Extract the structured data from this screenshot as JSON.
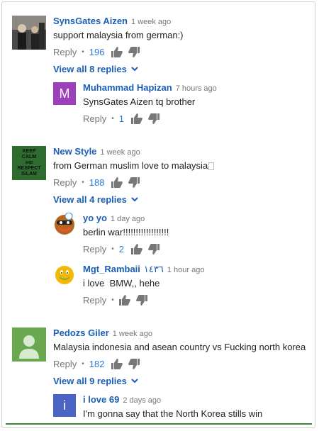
{
  "comments": [
    {
      "author": "SynsGates Aizen",
      "time": "1 week ago",
      "text": "support malaysia from german:)",
      "reply_label": "Reply",
      "likes": "196",
      "view_replies": "View all 8 replies",
      "avatar": "photo-avatar"
    },
    {
      "author": "Muhammad Hapizan",
      "time": "7 hours ago",
      "text": "SynsGates Aizen tq brother",
      "reply_label": "Reply",
      "likes": "1",
      "avatar_letter": "M",
      "avatar_color": "#9c3fbb"
    },
    {
      "author": "New Style",
      "time": "1 week ago",
      "text": "from German muslim love to malaysia",
      "reply_label": "Reply",
      "likes": "188",
      "view_replies": "View all 4 replies",
      "avatar_text": [
        "KEEP",
        "CALM",
        "AND",
        "RESPECT",
        "ISLAM"
      ],
      "avatar_color": "#2e6b2e"
    },
    {
      "author": "yo yo",
      "time": "1 day ago",
      "text": "berlin war!!!!!!!!!!!!!!!!!!",
      "reply_label": "Reply",
      "likes": "2",
      "avatar": "cartoon-face-avatar"
    },
    {
      "author": "Mgt_Rambaii",
      "author_suffix": "١٤٣٦",
      "time": "1 hour ago",
      "text": "i love  BMW,, hehe",
      "reply_label": "Reply",
      "avatar": "smiley-avatar"
    },
    {
      "author": "Pedozs Giler",
      "time": "1 week ago",
      "text": "Malaysia indonesia and asean country vs Fucking north korea",
      "reply_label": "Reply",
      "likes": "182",
      "view_replies": "View all 9 replies",
      "avatar": "default-user-avatar",
      "avatar_color": "#6aa84f"
    },
    {
      "author": "i love 69",
      "time": "2 days ago",
      "text": "I'm gonna say that the North Korea stills win",
      "avatar_letter": "i",
      "avatar_color": "#4a64c4"
    }
  ],
  "colors": {
    "link": "#1a5fb4",
    "likes": "#2b7bd8",
    "muted": "#767676",
    "accent_bar": "#3c8a3c"
  }
}
